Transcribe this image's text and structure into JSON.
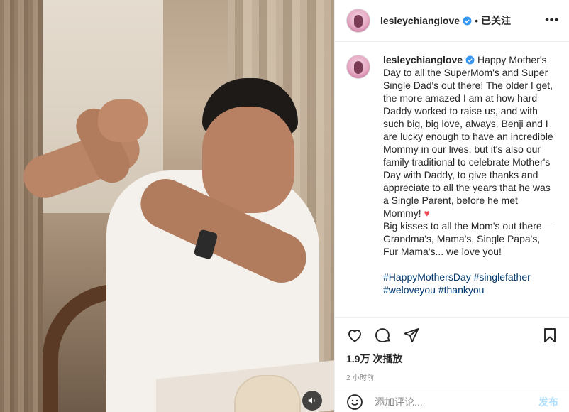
{
  "post": {
    "username": "lesleychianglove",
    "follow_status": "已关注",
    "separator": "•",
    "more_label": "•••"
  },
  "caption": {
    "username": "lesleychianglove",
    "text": "Happy Mother's Day to all the SuperMom's and Super Single Dad's out there! The older I get, the more amazed I am at how hard Daddy worked to raise us, and with such big, big love, always. Benji and I are lucky enough to have an incredible Mommy in our lives, but it's also our family traditional to celebrate Mother's Day with Daddy, to give thanks and appreciate to all the years that he was a Single Parent, before he met Mommy! ",
    "heart": "♥",
    "text2": "Big kisses to all the Mom's out there—Grandma's, Mama's, Single Papa's, Fur Mama's... we love you!",
    "hashtags": [
      "#HappyMothersDay",
      "#singlefather",
      "#weloveyou",
      "#thankyou"
    ]
  },
  "stats": {
    "views": "1.9万 次播放",
    "time_ago": "2 小时前"
  },
  "comment_box": {
    "placeholder": "添加评论...",
    "post_label": "发布"
  },
  "icons": {
    "like": "heart-icon",
    "comment": "comment-icon",
    "share": "share-icon",
    "save": "bookmark-icon",
    "emoji": "emoji-icon",
    "sound": "speaker-icon",
    "verified": "verified-badge-icon"
  },
  "colors": {
    "link": "#00376b",
    "verified": "#3897f0",
    "heart": "#ed4956",
    "muted": "#8e8e8e",
    "post_button": "#b2dffc"
  }
}
